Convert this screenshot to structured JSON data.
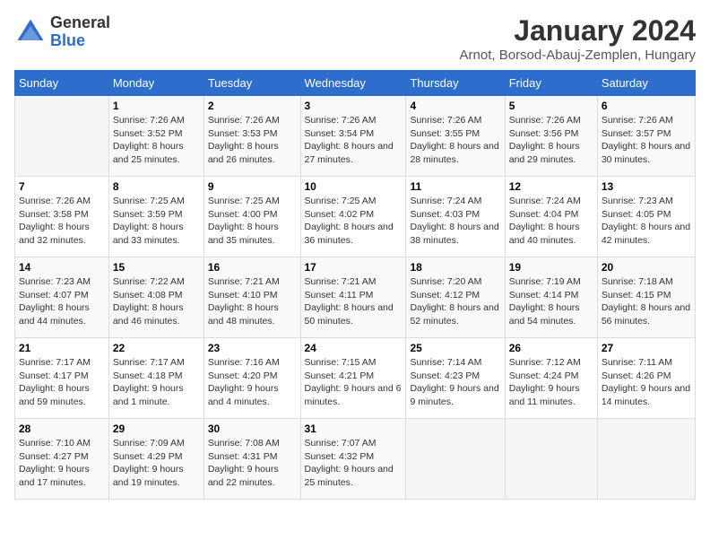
{
  "logo": {
    "general": "General",
    "blue": "Blue"
  },
  "title": "January 2024",
  "subtitle": "Arnot, Borsod-Abauj-Zemplen, Hungary",
  "headers": [
    "Sunday",
    "Monday",
    "Tuesday",
    "Wednesday",
    "Thursday",
    "Friday",
    "Saturday"
  ],
  "weeks": [
    [
      {
        "day": "",
        "sunrise": "",
        "sunset": "",
        "daylight": ""
      },
      {
        "day": "1",
        "sunrise": "Sunrise: 7:26 AM",
        "sunset": "Sunset: 3:52 PM",
        "daylight": "Daylight: 8 hours and 25 minutes."
      },
      {
        "day": "2",
        "sunrise": "Sunrise: 7:26 AM",
        "sunset": "Sunset: 3:53 PM",
        "daylight": "Daylight: 8 hours and 26 minutes."
      },
      {
        "day": "3",
        "sunrise": "Sunrise: 7:26 AM",
        "sunset": "Sunset: 3:54 PM",
        "daylight": "Daylight: 8 hours and 27 minutes."
      },
      {
        "day": "4",
        "sunrise": "Sunrise: 7:26 AM",
        "sunset": "Sunset: 3:55 PM",
        "daylight": "Daylight: 8 hours and 28 minutes."
      },
      {
        "day": "5",
        "sunrise": "Sunrise: 7:26 AM",
        "sunset": "Sunset: 3:56 PM",
        "daylight": "Daylight: 8 hours and 29 minutes."
      },
      {
        "day": "6",
        "sunrise": "Sunrise: 7:26 AM",
        "sunset": "Sunset: 3:57 PM",
        "daylight": "Daylight: 8 hours and 30 minutes."
      }
    ],
    [
      {
        "day": "7",
        "sunrise": "Sunrise: 7:26 AM",
        "sunset": "Sunset: 3:58 PM",
        "daylight": "Daylight: 8 hours and 32 minutes."
      },
      {
        "day": "8",
        "sunrise": "Sunrise: 7:25 AM",
        "sunset": "Sunset: 3:59 PM",
        "daylight": "Daylight: 8 hours and 33 minutes."
      },
      {
        "day": "9",
        "sunrise": "Sunrise: 7:25 AM",
        "sunset": "Sunset: 4:00 PM",
        "daylight": "Daylight: 8 hours and 35 minutes."
      },
      {
        "day": "10",
        "sunrise": "Sunrise: 7:25 AM",
        "sunset": "Sunset: 4:02 PM",
        "daylight": "Daylight: 8 hours and 36 minutes."
      },
      {
        "day": "11",
        "sunrise": "Sunrise: 7:24 AM",
        "sunset": "Sunset: 4:03 PM",
        "daylight": "Daylight: 8 hours and 38 minutes."
      },
      {
        "day": "12",
        "sunrise": "Sunrise: 7:24 AM",
        "sunset": "Sunset: 4:04 PM",
        "daylight": "Daylight: 8 hours and 40 minutes."
      },
      {
        "day": "13",
        "sunrise": "Sunrise: 7:23 AM",
        "sunset": "Sunset: 4:05 PM",
        "daylight": "Daylight: 8 hours and 42 minutes."
      }
    ],
    [
      {
        "day": "14",
        "sunrise": "Sunrise: 7:23 AM",
        "sunset": "Sunset: 4:07 PM",
        "daylight": "Daylight: 8 hours and 44 minutes."
      },
      {
        "day": "15",
        "sunrise": "Sunrise: 7:22 AM",
        "sunset": "Sunset: 4:08 PM",
        "daylight": "Daylight: 8 hours and 46 minutes."
      },
      {
        "day": "16",
        "sunrise": "Sunrise: 7:21 AM",
        "sunset": "Sunset: 4:10 PM",
        "daylight": "Daylight: 8 hours and 48 minutes."
      },
      {
        "day": "17",
        "sunrise": "Sunrise: 7:21 AM",
        "sunset": "Sunset: 4:11 PM",
        "daylight": "Daylight: 8 hours and 50 minutes."
      },
      {
        "day": "18",
        "sunrise": "Sunrise: 7:20 AM",
        "sunset": "Sunset: 4:12 PM",
        "daylight": "Daylight: 8 hours and 52 minutes."
      },
      {
        "day": "19",
        "sunrise": "Sunrise: 7:19 AM",
        "sunset": "Sunset: 4:14 PM",
        "daylight": "Daylight: 8 hours and 54 minutes."
      },
      {
        "day": "20",
        "sunrise": "Sunrise: 7:18 AM",
        "sunset": "Sunset: 4:15 PM",
        "daylight": "Daylight: 8 hours and 56 minutes."
      }
    ],
    [
      {
        "day": "21",
        "sunrise": "Sunrise: 7:17 AM",
        "sunset": "Sunset: 4:17 PM",
        "daylight": "Daylight: 8 hours and 59 minutes."
      },
      {
        "day": "22",
        "sunrise": "Sunrise: 7:17 AM",
        "sunset": "Sunset: 4:18 PM",
        "daylight": "Daylight: 9 hours and 1 minute."
      },
      {
        "day": "23",
        "sunrise": "Sunrise: 7:16 AM",
        "sunset": "Sunset: 4:20 PM",
        "daylight": "Daylight: 9 hours and 4 minutes."
      },
      {
        "day": "24",
        "sunrise": "Sunrise: 7:15 AM",
        "sunset": "Sunset: 4:21 PM",
        "daylight": "Daylight: 9 hours and 6 minutes."
      },
      {
        "day": "25",
        "sunrise": "Sunrise: 7:14 AM",
        "sunset": "Sunset: 4:23 PM",
        "daylight": "Daylight: 9 hours and 9 minutes."
      },
      {
        "day": "26",
        "sunrise": "Sunrise: 7:12 AM",
        "sunset": "Sunset: 4:24 PM",
        "daylight": "Daylight: 9 hours and 11 minutes."
      },
      {
        "day": "27",
        "sunrise": "Sunrise: 7:11 AM",
        "sunset": "Sunset: 4:26 PM",
        "daylight": "Daylight: 9 hours and 14 minutes."
      }
    ],
    [
      {
        "day": "28",
        "sunrise": "Sunrise: 7:10 AM",
        "sunset": "Sunset: 4:27 PM",
        "daylight": "Daylight: 9 hours and 17 minutes."
      },
      {
        "day": "29",
        "sunrise": "Sunrise: 7:09 AM",
        "sunset": "Sunset: 4:29 PM",
        "daylight": "Daylight: 9 hours and 19 minutes."
      },
      {
        "day": "30",
        "sunrise": "Sunrise: 7:08 AM",
        "sunset": "Sunset: 4:31 PM",
        "daylight": "Daylight: 9 hours and 22 minutes."
      },
      {
        "day": "31",
        "sunrise": "Sunrise: 7:07 AM",
        "sunset": "Sunset: 4:32 PM",
        "daylight": "Daylight: 9 hours and 25 minutes."
      },
      {
        "day": "",
        "sunrise": "",
        "sunset": "",
        "daylight": ""
      },
      {
        "day": "",
        "sunrise": "",
        "sunset": "",
        "daylight": ""
      },
      {
        "day": "",
        "sunrise": "",
        "sunset": "",
        "daylight": ""
      }
    ]
  ]
}
